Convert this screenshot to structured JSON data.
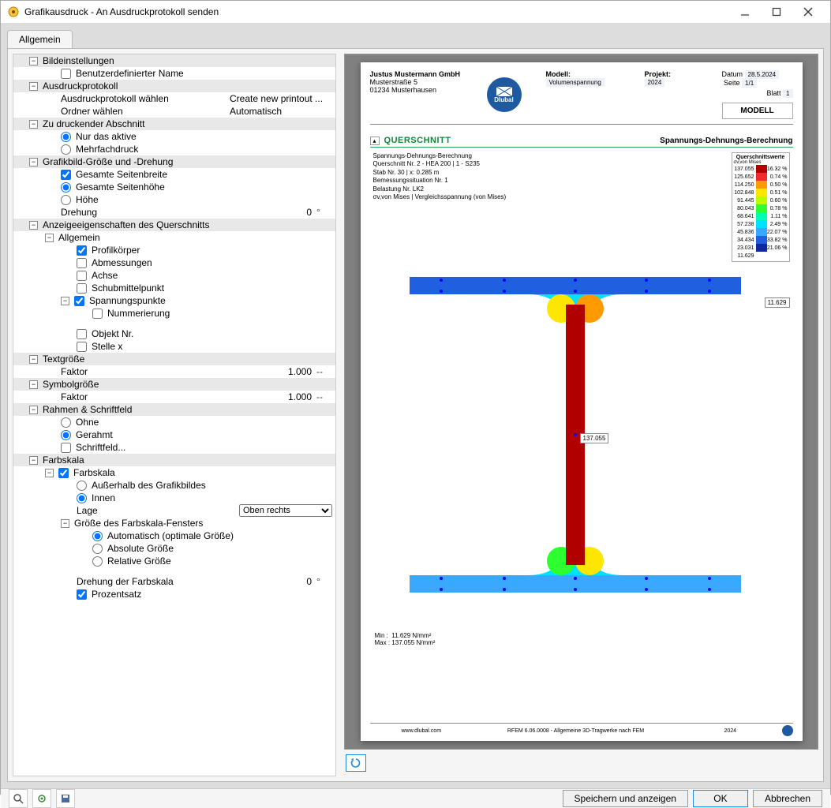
{
  "window": {
    "title": "Grafikausdruck - An Ausdruckprotokoll senden"
  },
  "tabs": {
    "general": "Allgemein"
  },
  "tree": {
    "bildeinstellungen": "Bildeinstellungen",
    "benutzerdef_name": "Benutzerdefinierter Name",
    "ausdruckprotokoll": "Ausdruckprotokoll",
    "ausdruckprotokoll_waehlen": "Ausdruckprotokoll wählen",
    "ausdruckprotokoll_waehlen_val": "Create new printout ...",
    "ordner_waehlen": "Ordner wählen",
    "ordner_waehlen_val": "Automatisch",
    "zu_druckender_abschnitt": "Zu druckender Abschnitt",
    "nur_das_aktive": "Nur das aktive",
    "mehrfachdruck": "Mehrfachdruck",
    "grafikbild": "Grafikbild-Größe und -Drehung",
    "gesamte_seitenbreite": "Gesamte Seitenbreite",
    "gesamte_seitenhoehe": "Gesamte Seitenhöhe",
    "hoehe": "Höhe",
    "drehung": "Drehung",
    "drehung_val": "0",
    "drehung_unit": "°",
    "anzeigeeigenschaften": "Anzeigeeigenschaften des Querschnitts",
    "allgemein": "Allgemein",
    "profilkoerper": "Profilkörper",
    "abmessungen": "Abmessungen",
    "achse": "Achse",
    "schubmittelpunkt": "Schubmittelpunkt",
    "spannungspunkte": "Spannungspunkte",
    "nummerierung": "Nummerierung",
    "objekt_nr": "Objekt Nr.",
    "stelle_x": "Stelle x",
    "textgroesse": "Textgröße",
    "faktor": "Faktor",
    "text_faktor_val": "1.000",
    "text_faktor_unit": "--",
    "symbolgroesse": "Symbolgröße",
    "symbol_faktor_val": "1.000",
    "symbol_faktor_unit": "--",
    "rahmen_schriftfeld": "Rahmen & Schriftfeld",
    "ohne": "Ohne",
    "gerahmt": "Gerahmt",
    "schriftfeld": "Schriftfeld...",
    "farbskala": "Farbskala",
    "ausserhalb": "Außerhalb des Grafikbildes",
    "innen": "Innen",
    "lage": "Lage",
    "lage_val": "Oben rechts",
    "groesse_farbskala": "Größe des Farbskala-Fensters",
    "automatisch": "Automatisch (optimale Größe)",
    "absolute_groesse": "Absolute Größe",
    "relative_groesse": "Relative Größe",
    "drehung_farbskala": "Drehung der Farbskala",
    "drehung_farbskala_val": "0",
    "drehung_farbskala_unit": "°",
    "prozentsatz": "Prozentsatz"
  },
  "preview": {
    "company": "Justus Mustermann GmbH",
    "street": "Musterstraße 5",
    "city": "01234 Musterhausen",
    "logo_text": "Dlubal",
    "modell_lbl": "Modell:",
    "modell_val": "Volumenspannung",
    "projekt_lbl": "Projekt:",
    "projekt_val": "2024",
    "datum_lbl": "Datum",
    "datum_val": "28.5.2024",
    "seite_lbl": "Seite",
    "seite_val": "1/1",
    "blatt_lbl": "Blatt",
    "blatt_val": "1",
    "model_box": "MODELL",
    "section_title": "QUERSCHNITT",
    "section_subtitle": "Spannungs-Dehnungs-Berechnung",
    "info_l1": "Spannungs-Dehnungs-Berechnung",
    "info_l2": "Querschnitt Nr. 2 - HEA 200 | 1 - S235",
    "info_l3": "Stab Nr. 30 | x: 0.285 m",
    "info_l4": "Bemessungssituation Nr. 1",
    "info_l5": "Belastung Nr. LK2",
    "info_l6": "σv,von Mises | Vergleichsspannung (von Mises)",
    "cb_title": "Querschnittswerte",
    "cb_unit": "σv,von Mises",
    "min_label": "Min :",
    "min_val": "11.629 N/mm²",
    "max_label": "Max :",
    "max_val": "137.055 N/mm²",
    "footer_url": "www.dlubal.com",
    "footer_app": "RFEM 6.06.0008 - Allgemeine 3D-Tragwerke nach FEM",
    "footer_year": "2024",
    "callout1": "11.629",
    "callout2": "137.055"
  },
  "chart_data": {
    "type": "table",
    "title": "Querschnittswerte σv,von Mises",
    "values": [
      137.055,
      125.652,
      114.25,
      102.848,
      91.445,
      80.043,
      68.641,
      57.238,
      45.836,
      34.434,
      23.031,
      11.629
    ],
    "percent": [
      16.32,
      0.74,
      0.5,
      0.51,
      0.6,
      0.78,
      1.11,
      2.49,
      22.07,
      33.82,
      21.06
    ],
    "colors": [
      "#b00000",
      "#ef2b2b",
      "#ff9a00",
      "#ffe600",
      "#b8ff00",
      "#2eff2e",
      "#00ffb0",
      "#00e0ff",
      "#3aa8ff",
      "#1f5fe0",
      "#0b2aa0"
    ]
  },
  "footer": {
    "save_show": "Speichern und anzeigen",
    "ok": "OK",
    "cancel": "Abbrechen"
  }
}
